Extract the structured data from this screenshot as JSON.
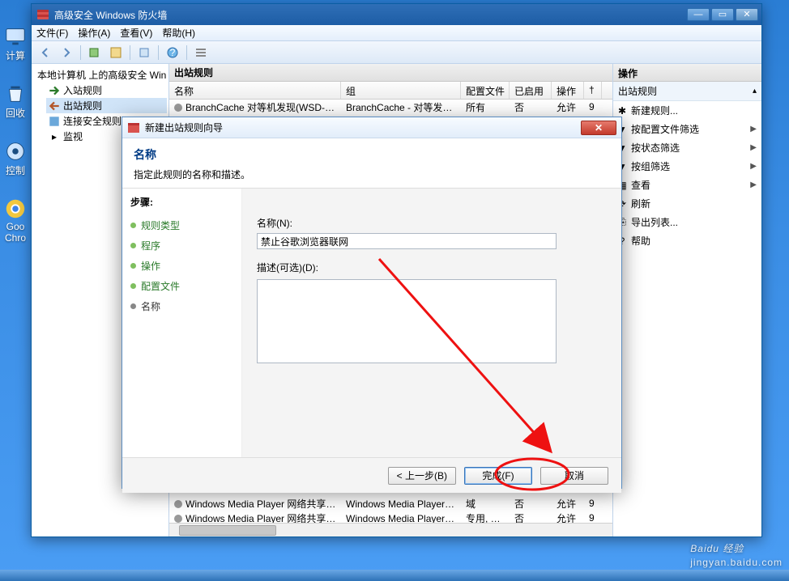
{
  "desktop_icons": [
    "计算",
    "回收",
    "控制",
    "Goo Chro"
  ],
  "window": {
    "title": "高级安全 Windows 防火墙",
    "menus": [
      "文件(F)",
      "操作(A)",
      "查看(V)",
      "帮助(H)"
    ],
    "tree": {
      "root": "本地计算机 上的高级安全 Win",
      "children": [
        "入站规则",
        "出站规则",
        "连接安全规则",
        "监视"
      ],
      "selected": 1
    },
    "list": {
      "header": "出站规则",
      "columns": [
        "名称",
        "组",
        "配置文件",
        "已启用",
        "操作",
        "†"
      ],
      "rows": [
        {
          "name": "BranchCache 对等机发现(WSD-Out)",
          "group": "BranchCache - 对等发现...",
          "profile": "所有",
          "enabled": "否",
          "action": "允许",
          "t": "9"
        },
        {
          "name": "Windows Media Player 网络共享服务(...",
          "group": "Windows Media Player 网...",
          "profile": "域",
          "enabled": "否",
          "action": "允许",
          "t": "9"
        },
        {
          "name": "Windows Media Player 网络共享服务(...",
          "group": "Windows Media Player 网...",
          "profile": "专用, 公用",
          "enabled": "否",
          "action": "允许",
          "t": "9"
        }
      ]
    },
    "actions": {
      "header": "操作",
      "group": "出站规则",
      "items": [
        {
          "label": "新建规则...",
          "icon": "new"
        },
        {
          "label": "按配置文件筛选",
          "icon": "filter",
          "sub": true
        },
        {
          "label": "按状态筛选",
          "icon": "filter",
          "sub": true
        },
        {
          "label": "按组筛选",
          "icon": "filter",
          "sub": true
        },
        {
          "label": "查看",
          "icon": "view",
          "sub": true
        },
        {
          "label": "刷新",
          "icon": "refresh"
        },
        {
          "label": "导出列表...",
          "icon": "export"
        },
        {
          "label": "帮助",
          "icon": "help"
        }
      ]
    }
  },
  "wizard": {
    "title": "新建出站规则向导",
    "heading": "名称",
    "subheading": "指定此规则的名称和描述。",
    "steps_label": "步骤:",
    "steps": [
      "规则类型",
      "程序",
      "操作",
      "配置文件",
      "名称"
    ],
    "current_step": 4,
    "name_label": "名称(N):",
    "name_value": "禁止谷歌浏览器联网",
    "desc_label": "描述(可选)(D):",
    "desc_value": "",
    "btn_back": "< 上一步(B)",
    "btn_finish": "完成(F)",
    "btn_cancel": "取消"
  },
  "watermark": {
    "brand": "Baidu 经验",
    "url": "jingyan.baidu.com"
  }
}
